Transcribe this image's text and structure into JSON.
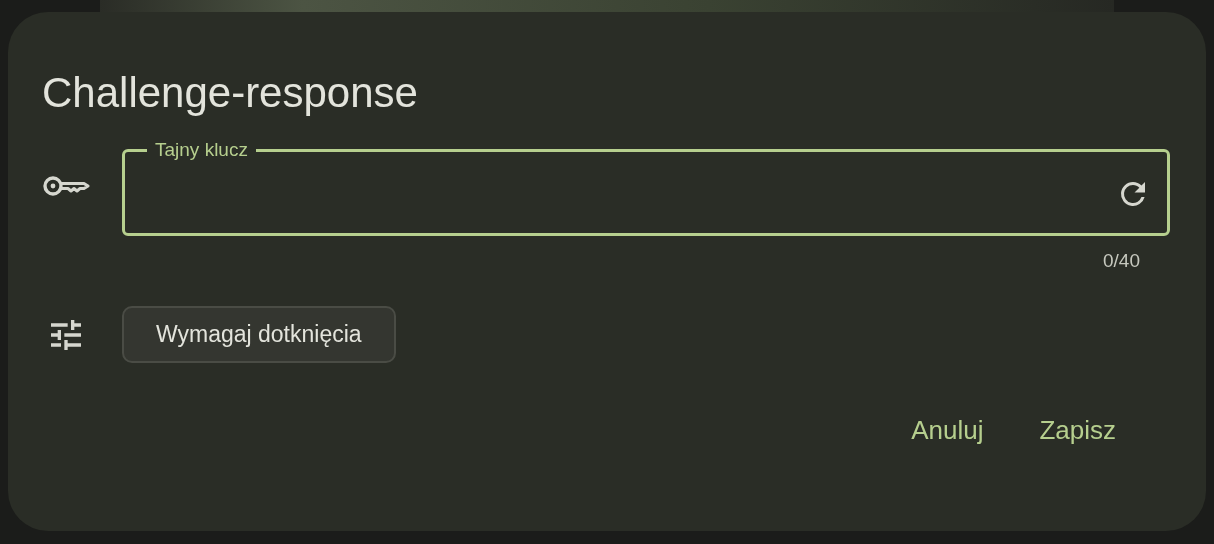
{
  "dialog": {
    "title": "Challenge-response",
    "secret_field": {
      "label": "Tajny klucz",
      "focused": true,
      "counter": "0/40"
    },
    "chips": [
      {
        "label": "Wymagaj dotknięcia",
        "selected": false
      }
    ],
    "buttons": [
      "Anuluj",
      "Zapisz"
    ]
  }
}
